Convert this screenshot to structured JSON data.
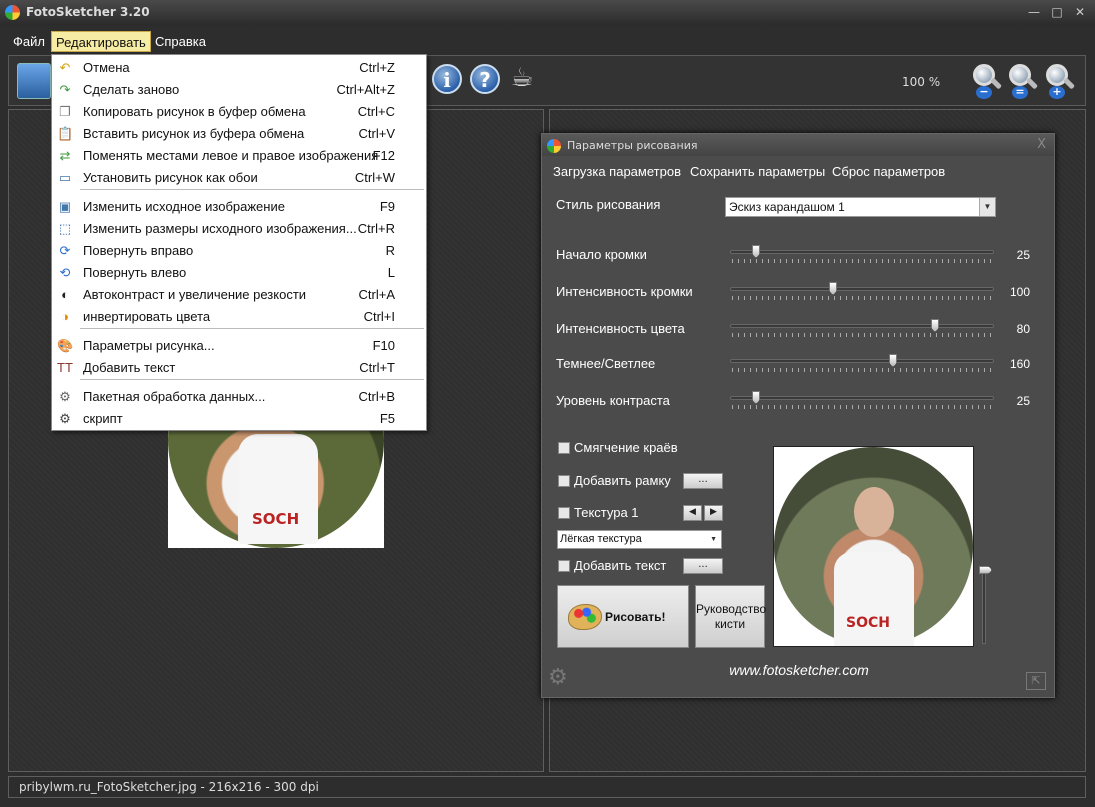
{
  "window": {
    "title": "FotoSketcher 3.20",
    "controls": {
      "minimize": "—",
      "maximize": "□",
      "close": "✕"
    }
  },
  "menubar": {
    "items": [
      "Файл",
      "Редактировать",
      "Справка"
    ],
    "active": "Редактировать"
  },
  "toolbar": {
    "zoom_level": "100 %",
    "zoom_signs": [
      "−",
      "=",
      "+"
    ]
  },
  "edit_menu": {
    "items": [
      {
        "label": "Отмена",
        "shortcut": "Ctrl+Z",
        "icon": "undo-icon",
        "glyph": "↶",
        "color": "#d4a017"
      },
      {
        "label": "Сделать заново",
        "shortcut": "Ctrl+Alt+Z",
        "icon": "redo-icon",
        "glyph": "↷",
        "color": "#3a9a3a"
      },
      {
        "label": "Копировать рисунок в буфер обмена",
        "shortcut": "Ctrl+C",
        "icon": "copy-icon",
        "glyph": "❐",
        "color": "#777777"
      },
      {
        "label": "Вставить рисунок из буфера обмена",
        "shortcut": "Ctrl+V",
        "icon": "paste-icon",
        "glyph": "📋",
        "color": "#8a6a3a"
      },
      {
        "label": "Поменять местами левое и правое изображения",
        "shortcut": "F12",
        "icon": "swap-icon",
        "glyph": "⇄",
        "color": "#3a9a3a"
      },
      {
        "label": "Установить рисунок как обои",
        "shortcut": "Ctrl+W",
        "icon": "wallpaper-icon",
        "glyph": "▭",
        "color": "#4477aa"
      },
      {
        "label": "Изменить исходное изображение",
        "shortcut": "F9",
        "icon": "edit-image-icon",
        "glyph": "▣",
        "color": "#4477aa"
      },
      {
        "label": "Изменить размеры исходного изображения...",
        "shortcut": "Ctrl+R",
        "icon": "resize-icon",
        "glyph": "⬚",
        "color": "#2a5faa"
      },
      {
        "label": "Повернуть вправо",
        "shortcut": "R",
        "icon": "rotate-right-icon",
        "glyph": "⟳",
        "color": "#2a6fd0"
      },
      {
        "label": "Повернуть влево",
        "shortcut": "L",
        "icon": "rotate-left-icon",
        "glyph": "⟲",
        "color": "#2a6fd0"
      },
      {
        "label": "Автоконтраст и увеличение резкости",
        "shortcut": "Ctrl+A",
        "icon": "contrast-icon",
        "glyph": "◐",
        "color": "#222222"
      },
      {
        "label": "инвертировать цвета",
        "shortcut": "Ctrl+I",
        "icon": "invert-icon",
        "glyph": "◑",
        "color": "#e88a00"
      },
      {
        "label": "Параметры рисунка...",
        "shortcut": "F10",
        "icon": "palette-icon",
        "glyph": "🎨",
        "color": "#c8902a"
      },
      {
        "label": "Добавить текст",
        "shortcut": "Ctrl+T",
        "icon": "text-icon",
        "glyph": "TT",
        "color": "#8a3a2a"
      },
      {
        "label": "Пакетная обработка данных...",
        "shortcut": "Ctrl+B",
        "icon": "batch-icon",
        "glyph": "⚙",
        "color": "#666666"
      },
      {
        "label": "скрипт",
        "shortcut": "F5",
        "icon": "script-icon",
        "glyph": "⚙",
        "color": "#444444"
      }
    ]
  },
  "dialog": {
    "title": "Параметры рисования",
    "close": "X",
    "menu": [
      "Загрузка параметров",
      "Сохранить параметры",
      "Сброс параметров"
    ],
    "style_label": "Стиль рисования",
    "style_value": "Эскиз карандашом 1",
    "sliders": [
      {
        "label": "Начало кромки",
        "value": "25",
        "fraction": 0.1
      },
      {
        "label": "Интенсивность кромки",
        "value": "100",
        "fraction": 0.395
      },
      {
        "label": "Интенсивность цвета",
        "value": "80",
        "fraction": 0.79
      },
      {
        "label": "Темнее/Светлее",
        "value": "160",
        "fraction": 0.625
      },
      {
        "label": "Уровень контраста",
        "value": "25",
        "fraction": 0.1
      }
    ],
    "checkboxes": {
      "smooth_edges": "Смягчение краёв",
      "add_frame": "Добавить рамку",
      "texture": "Текстура 1",
      "add_text": "Добавить текст"
    },
    "ellipsis": "...",
    "texture_value": "Лёгкая текстура",
    "draw_button": "Рисовать!",
    "guide_button": "Руководство кисти",
    "website": "www.fotosketcher.com"
  },
  "photo": {
    "shirt_text": "SOCH"
  },
  "preview": {
    "shirt_text": "SOCH"
  },
  "status": {
    "text": "pribylwm.ru_FotoSketcher.jpg - 216x216 - 300 dpi"
  }
}
